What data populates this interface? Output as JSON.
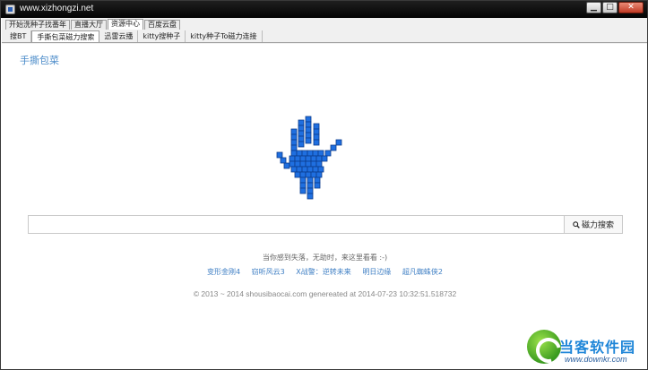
{
  "window": {
    "title": "www.xizhongzi.net",
    "controls": {
      "minimize": "▁",
      "maximize": "□",
      "close": "✕"
    }
  },
  "top_tabs": [
    {
      "label": "开始洗种子找番年",
      "active": false
    },
    {
      "label": "直播大厅",
      "active": false
    },
    {
      "label": "资源中心",
      "active": true
    },
    {
      "label": "百度云盘",
      "active": false
    }
  ],
  "sub_tabs": [
    {
      "label": "搜BT",
      "active": false
    },
    {
      "label": "手撕包菜磁力搜索",
      "active": true
    },
    {
      "label": "迅雷云播",
      "active": false
    },
    {
      "label": "kitty搜种子",
      "active": false
    },
    {
      "label": "kitty种子To磁力连接",
      "active": false
    }
  ],
  "page": {
    "brand": "手撕包菜",
    "logo_icon": "pixel-hand-logo-icon",
    "search": {
      "value": "",
      "placeholder": "",
      "button_label": "磁力搜索",
      "button_icon": "search-icon"
    },
    "tip": "当你感到失落，无助时，来这里看看 :-)",
    "links": [
      "变形金刚4",
      "窃听风云3",
      "X战警：逆转未来",
      "明日边缘",
      "超凡蜘蛛侠2"
    ],
    "copyright": "© 2013 ~ 2014 shousibaocai.com genereated at 2014-07-23 10:32:51.518732"
  },
  "watermark": {
    "title": "当客软件园",
    "url": "www.downkr.com"
  },
  "colors": {
    "titlebar": "#050505",
    "brand_blue": "#4a8bc9",
    "link_blue": "#3f7fc4",
    "logo_blue": "#1f6fe0"
  }
}
